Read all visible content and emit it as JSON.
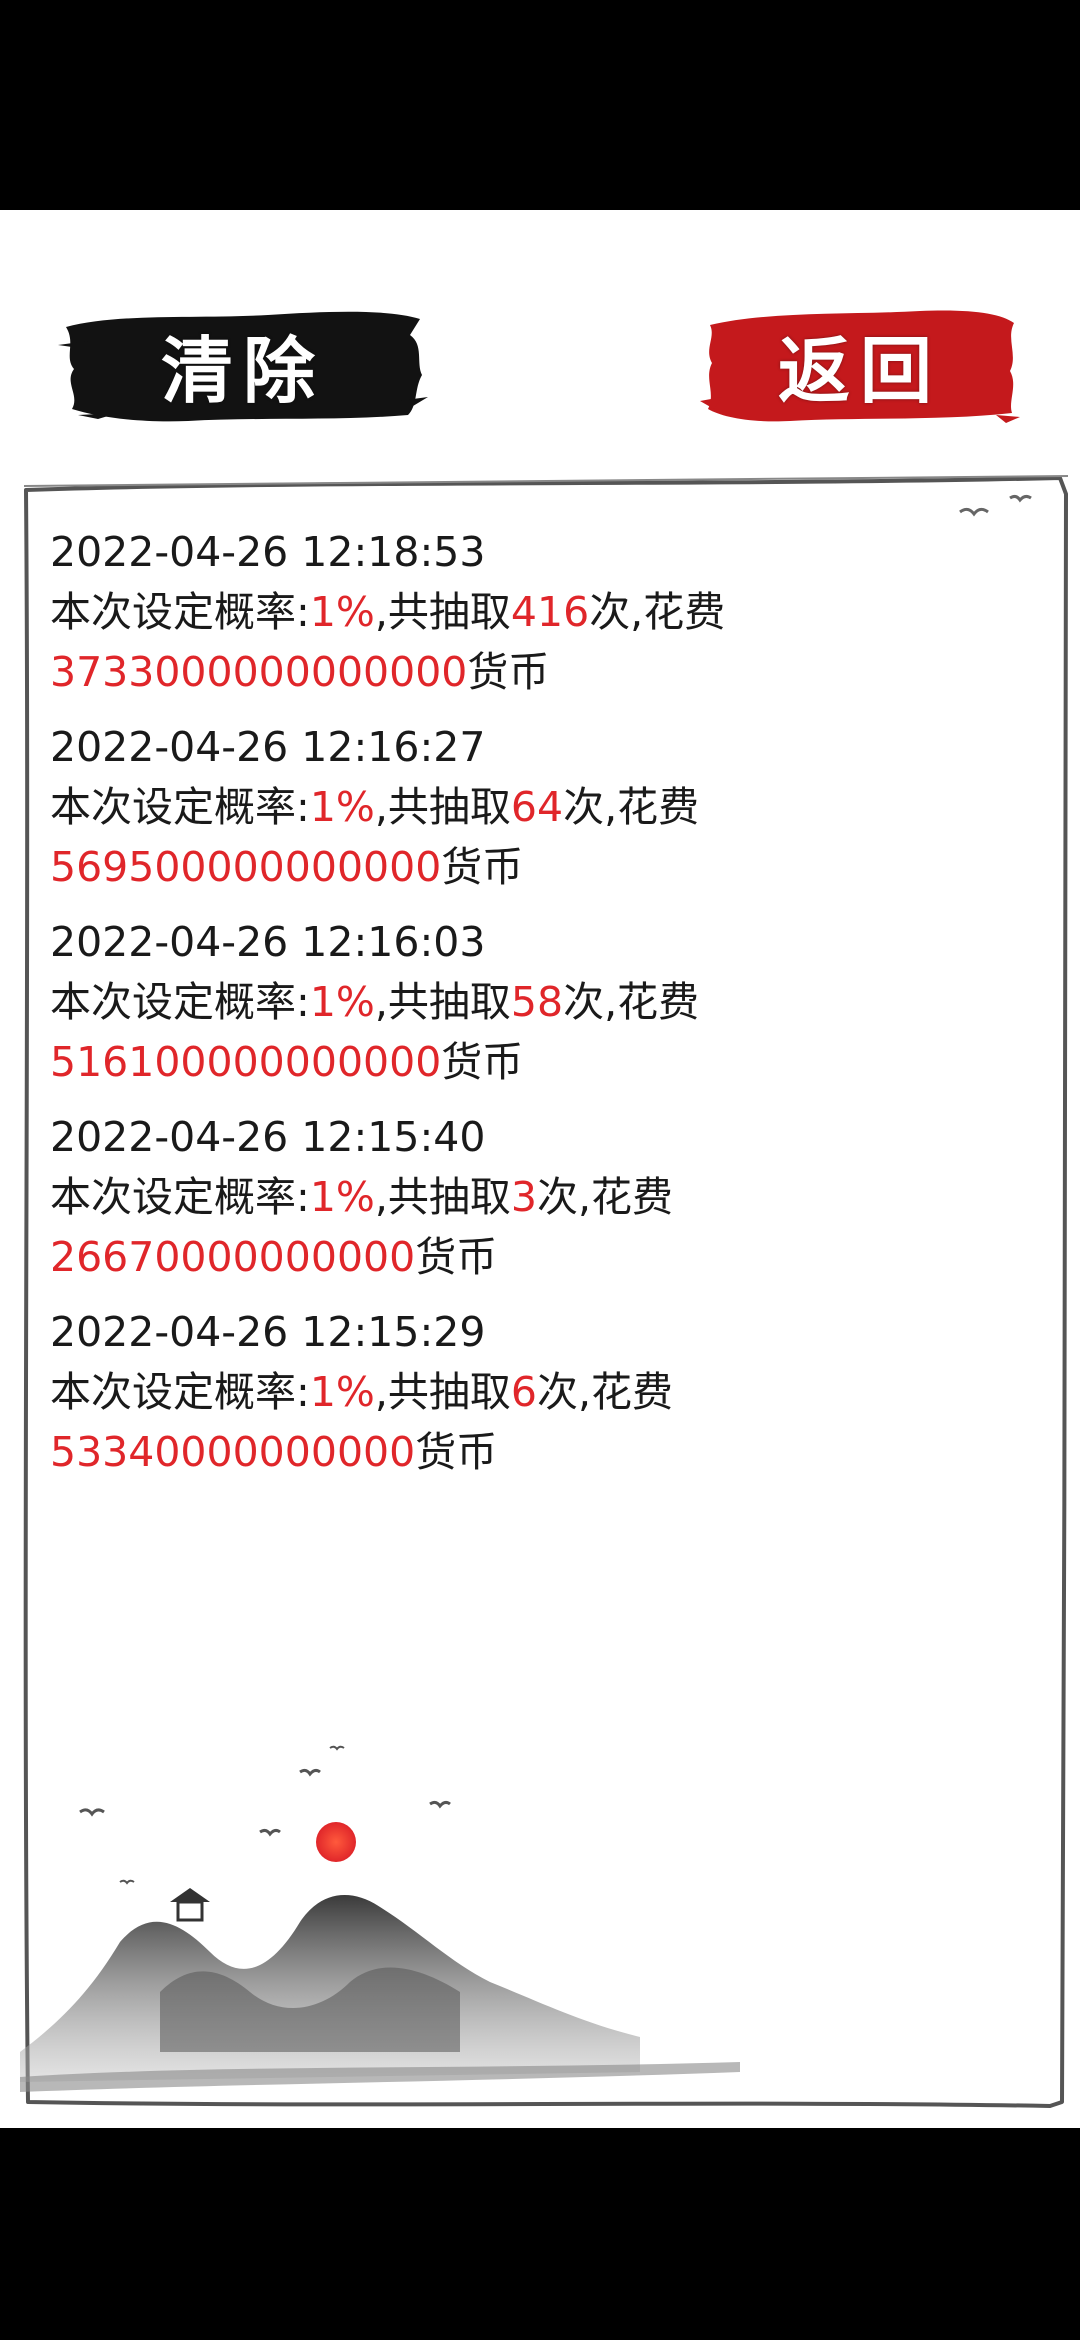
{
  "buttons": {
    "clear_label": "清除",
    "back_label": "返回"
  },
  "record_text": {
    "prefix": "本次设定概率:",
    "mid": ",共抽取",
    "suffix_count": "次,花费",
    "currency": "货币"
  },
  "records": [
    {
      "time": "2022-04-26 12:18:53",
      "probability": "1%",
      "count": "416",
      "cost": "3733000000000000"
    },
    {
      "time": "2022-04-26 12:16:27",
      "probability": "1%",
      "count": "64",
      "cost": "569500000000000"
    },
    {
      "time": "2022-04-26 12:16:03",
      "probability": "1%",
      "count": "58",
      "cost": "516100000000000"
    },
    {
      "time": "2022-04-26 12:15:40",
      "probability": "1%",
      "count": "3",
      "cost": "26670000000000"
    },
    {
      "time": "2022-04-26 12:15:29",
      "probability": "1%",
      "count": "6",
      "cost": "53340000000000"
    }
  ],
  "colors": {
    "accent_red": "#e0262a",
    "ink_black": "#111111",
    "seal_red": "#c4191c"
  }
}
